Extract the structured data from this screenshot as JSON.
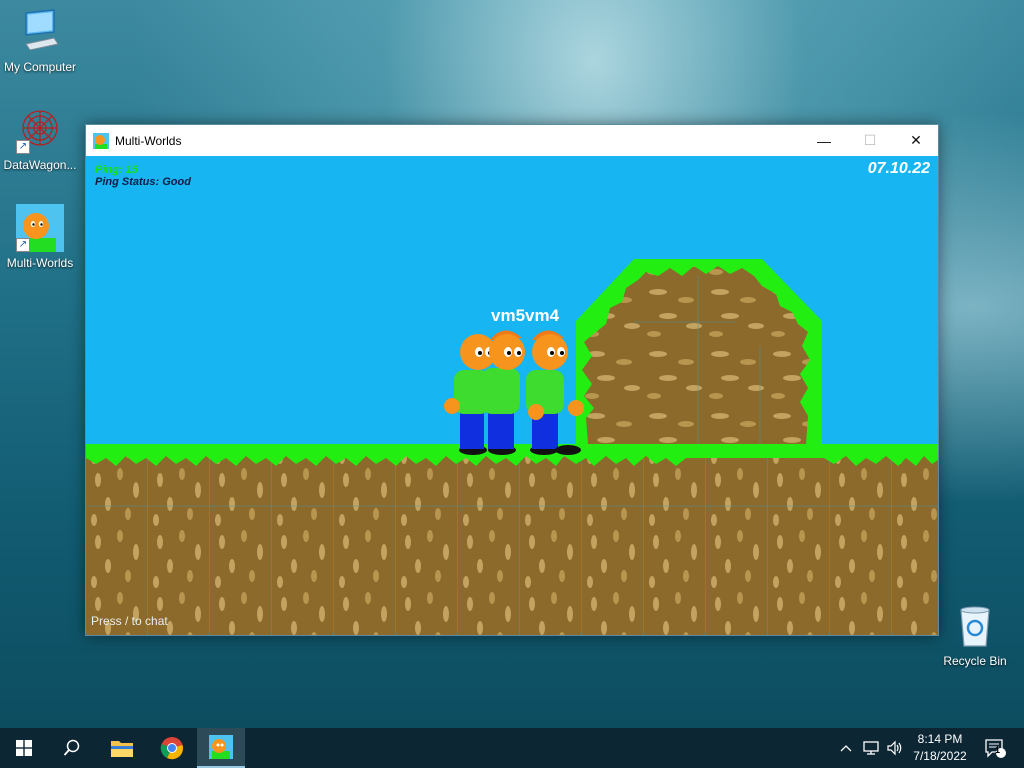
{
  "desktop": {
    "icons": [
      {
        "label": "My Computer",
        "icon": "computer-icon"
      },
      {
        "label": "DataWagon...",
        "icon": "datawagon-icon"
      },
      {
        "label": "Multi-Worlds",
        "icon": "multi-worlds-icon"
      },
      {
        "label": "Recycle Bin",
        "icon": "recycle-bin-icon"
      }
    ]
  },
  "window": {
    "title": "Multi-Worlds",
    "buttons": {
      "minimize": "—",
      "maximize": "☐",
      "close": "✕"
    }
  },
  "game": {
    "ping_label": "Ping: 15",
    "ping_status": "Ping Status: Good",
    "date": "07.10.22",
    "player_names": "vm5vm4",
    "chat_hint": "Press / to chat",
    "colors": {
      "sky": "#17b5f1",
      "grass": "#22ee11",
      "dirt": "#8b6a2c",
      "dirt_spot": "#c4a360",
      "skin": "#f7941d",
      "shirt": "#3ddc2f",
      "pants": "#1030e0"
    }
  },
  "taskbar": {
    "apps": [
      {
        "name": "start",
        "icon": "windows-logo-icon"
      },
      {
        "name": "search",
        "icon": "search-icon"
      },
      {
        "name": "file-explorer",
        "icon": "folder-icon"
      },
      {
        "name": "chrome",
        "icon": "chrome-icon"
      },
      {
        "name": "multi-worlds",
        "icon": "multi-worlds-icon",
        "active": true
      }
    ],
    "tray": {
      "time": "8:14 PM",
      "date": "7/18/2022",
      "notification_count": "1"
    }
  }
}
